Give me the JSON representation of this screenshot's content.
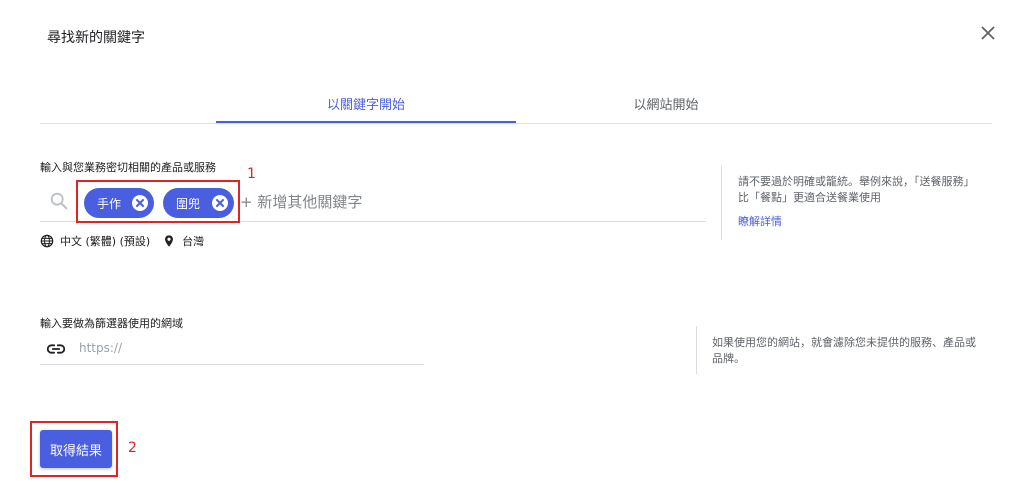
{
  "dialog": {
    "title": "尋找新的關鍵字",
    "close_icon": "close-icon"
  },
  "tabs": [
    {
      "label": "以關鍵字開始",
      "active": true
    },
    {
      "label": "以網站開始",
      "active": false
    }
  ],
  "keywords": {
    "label": "輸入與您業務密切相關的產品或服務",
    "chips": [
      {
        "label": "手作"
      },
      {
        "label": "圍兜"
      }
    ],
    "add_placeholder": "+ 新增其他關鍵字",
    "language": "中文 (繁體) (預設)",
    "location": "台灣",
    "hint": "請不要過於明確或籠統。舉例來說，「送餐服務」比「餐點」更適合送餐業使用",
    "hint_link": "瞭解詳情"
  },
  "url_filter": {
    "label": "輸入要做為篩選器使用的網域",
    "placeholder": "https://",
    "value": "",
    "hint": "如果使用您的網站，就會濾除您未提供的服務、產品或品牌。"
  },
  "submit_label": "取得結果",
  "annotations": [
    {
      "number": "1"
    },
    {
      "number": "2"
    }
  ],
  "colors": {
    "accent": "#4a5ee0",
    "highlight": "#e02424"
  }
}
